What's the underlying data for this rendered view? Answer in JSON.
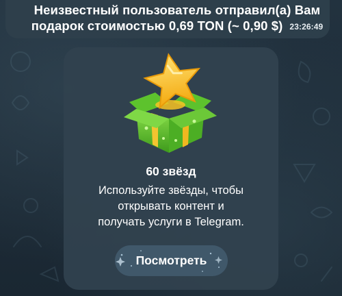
{
  "service_message": {
    "line1": "Неизвестный пользователь отправил(а) Вам",
    "line2": "подарок стоимостью 0,69 TON (~ 0,90 $)",
    "time": "23:26:49"
  },
  "gift": {
    "image_icon": "star-gift-box-icon",
    "title": "60 звёзд",
    "description_lines": [
      "Используйте звёзды, чтобы",
      "открывать контент и",
      "получать услуги в Telegram."
    ],
    "button_label": "Посмотреть"
  },
  "colors": {
    "chat_background": "#1c2a36",
    "bubble_background": "#2f404c",
    "card_background": "#31424f",
    "button_background": "#40586a",
    "text": "#ffffff",
    "star": "#f7c325",
    "box": "#6fcf3a"
  }
}
